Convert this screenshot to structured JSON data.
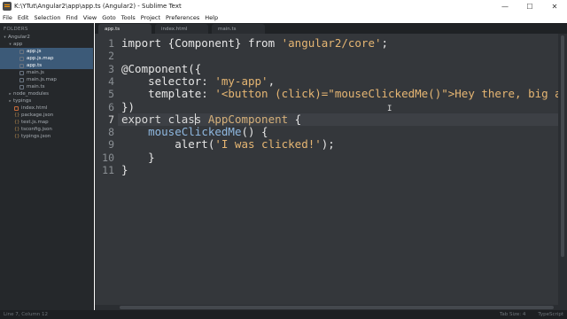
{
  "window": {
    "title": "K:\\YTut\\Angular2\\app\\app.ts (Angular2) - Sublime Text",
    "minimize": "—",
    "maximize": "☐",
    "close": "✕"
  },
  "menu": [
    "File",
    "Edit",
    "Selection",
    "Find",
    "View",
    "Goto",
    "Tools",
    "Project",
    "Preferences",
    "Help"
  ],
  "sidebar": {
    "header": "FOLDERS",
    "items": [
      {
        "label": "Angular2",
        "arrow": "▾",
        "icon": "none"
      },
      {
        "label": "app",
        "arrow": "▾",
        "icon": "none"
      },
      {
        "label": "app.js",
        "icon": "js"
      },
      {
        "label": "app.js.map",
        "icon": "js"
      },
      {
        "label": "app.ts",
        "icon": "ts"
      },
      {
        "label": "main.js",
        "icon": "js"
      },
      {
        "label": "main.js.map",
        "icon": "js"
      },
      {
        "label": "main.ts",
        "icon": "ts"
      },
      {
        "label": "node_modules",
        "arrow": "▸",
        "icon": "none"
      },
      {
        "label": "typings",
        "arrow": "▸",
        "icon": "none"
      },
      {
        "label": "index.html",
        "icon": "html"
      },
      {
        "label": "package.json",
        "icon": "json"
      },
      {
        "label": "test.js.map",
        "icon": "json"
      },
      {
        "label": "tsconfig.json",
        "icon": "json"
      },
      {
        "label": "typings.json",
        "icon": "json"
      }
    ]
  },
  "tabs": [
    {
      "label": "app.ts",
      "active": true
    },
    {
      "label": "index.html",
      "active": false
    },
    {
      "label": "main.ts",
      "active": false
    }
  ],
  "editor": {
    "line_numbers": [
      "1",
      "2",
      "3",
      "4",
      "5",
      "6",
      "7",
      "8",
      "9",
      "10",
      "11"
    ],
    "lines": [
      [
        {
          "t": "import {Component} from ",
          "c": "plain"
        },
        {
          "t": "'angular2/core'",
          "c": "str"
        },
        {
          "t": ";",
          "c": "plain"
        }
      ],
      [],
      [
        {
          "t": "@Component({",
          "c": "plain"
        }
      ],
      [
        {
          "t": "    selector: ",
          "c": "plain"
        },
        {
          "t": "'my-app'",
          "c": "str"
        },
        {
          "t": ",",
          "c": "plain"
        }
      ],
      [
        {
          "t": "    template: ",
          "c": "plain"
        },
        {
          "t": "'<button (click)=\"mouseClickedMe()\">Hey there, big ar",
          "c": "str"
        }
      ],
      [
        {
          "t": "})",
          "c": "plain"
        }
      ],
      [
        {
          "t": "export class ",
          "c": "kw"
        },
        {
          "t": "AppComponent",
          "c": "cls"
        },
        {
          "t": " {",
          "c": "plain"
        }
      ],
      [
        {
          "t": "    ",
          "c": "plain"
        },
        {
          "t": "mouseClickedMe",
          "c": "fn"
        },
        {
          "t": "() {",
          "c": "plain"
        }
      ],
      [
        {
          "t": "        alert(",
          "c": "plain"
        },
        {
          "t": "'I was clicked!'",
          "c": "str"
        },
        {
          "t": ");",
          "c": "plain"
        }
      ],
      [
        {
          "t": "    }",
          "c": "plain"
        }
      ],
      [
        {
          "t": "}",
          "c": "plain"
        }
      ]
    ],
    "current_line": 7
  },
  "status": {
    "left": "Line 7, Column 12",
    "tab_size": "Tab Size: 4",
    "syntax": "TypeScript"
  },
  "colors": {
    "editor_bg": "#34373b",
    "sidebar_bg": "#25282b",
    "selected_row": "#3c5a78",
    "string": "#e6b673",
    "function": "#8fb8e0"
  }
}
